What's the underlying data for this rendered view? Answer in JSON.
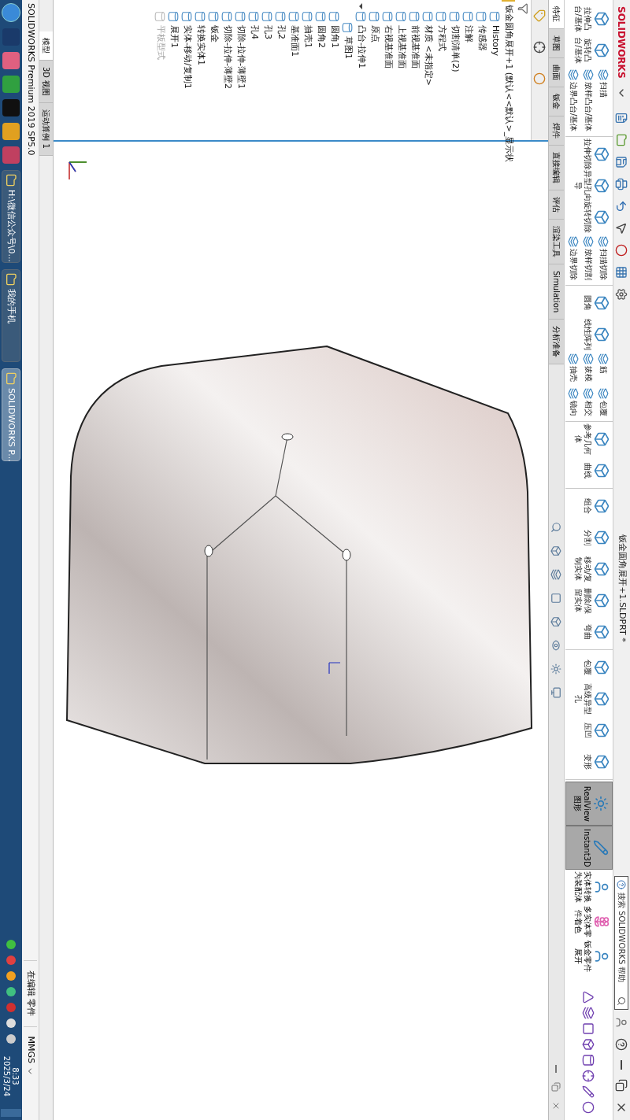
{
  "title_bar": {
    "logo": "SOLIDWORKS",
    "title": "钣金圆角展开+1.SLDPRT *",
    "search": {
      "placeholder": "搜索 SOLIDWORKS 帮助"
    }
  },
  "ribbon": {
    "groups": [
      {
        "items": [
          {
            "kind": "large",
            "label": "拉伸凸台/基体"
          },
          {
            "kind": "large",
            "label": "旋转凸台/基体"
          },
          {
            "kind": "small",
            "label": "扫描"
          },
          {
            "kind": "small",
            "label": "放样凸台/基体"
          },
          {
            "kind": "small",
            "label": "边界凸台/基体"
          }
        ]
      },
      {
        "items": [
          {
            "kind": "large",
            "label": "拉伸切除"
          },
          {
            "kind": "large",
            "label": "异型孔向导"
          },
          {
            "kind": "large",
            "label": "旋转切除"
          },
          {
            "kind": "small",
            "label": "扫描切除"
          },
          {
            "kind": "small",
            "label": "放样切割"
          },
          {
            "kind": "small",
            "label": "边界切除"
          }
        ]
      },
      {
        "items": [
          {
            "kind": "large",
            "label": "圆角"
          },
          {
            "kind": "large",
            "label": "线性阵列"
          },
          {
            "kind": "small",
            "label": "筋"
          },
          {
            "kind": "small",
            "label": "拔模"
          },
          {
            "kind": "small",
            "label": "抽壳"
          },
          {
            "kind": "small",
            "label": "包覆"
          },
          {
            "kind": "small",
            "label": "相交"
          },
          {
            "kind": "small",
            "label": "镜向"
          }
        ]
      },
      {
        "items": [
          {
            "kind": "large",
            "label": "参考几何体"
          },
          {
            "kind": "large",
            "label": "曲线"
          }
        ]
      },
      {
        "items": [
          {
            "kind": "large",
            "label": "组合"
          },
          {
            "kind": "large",
            "label": "分割"
          },
          {
            "kind": "large",
            "label": "移动/复制实体"
          },
          {
            "kind": "large",
            "label": "删除/保留实体"
          },
          {
            "kind": "large",
            "label": "弯曲"
          }
        ]
      },
      {
        "items": [
          {
            "kind": "large",
            "label": "包覆"
          },
          {
            "kind": "large",
            "label": "高级异型孔"
          },
          {
            "kind": "large",
            "label": "压凹"
          },
          {
            "kind": "large",
            "label": "变形"
          }
        ]
      }
    ],
    "toggles": [
      {
        "label": "RealView 图形",
        "pressed": true
      },
      {
        "label": "Instant3D",
        "pressed": true
      }
    ],
    "extras": [
      {
        "label": "实体转换为装配体"
      },
      {
        "label": "多实体零件着色"
      },
      {
        "label": "钣金零件展开"
      }
    ]
  },
  "tabs": [
    {
      "label": "特征",
      "selected": true
    },
    {
      "label": "草图",
      "selected": false
    },
    {
      "label": "曲面",
      "selected": false
    },
    {
      "label": "钣金",
      "selected": false
    },
    {
      "label": "焊件",
      "selected": false
    },
    {
      "label": "直接编辑",
      "selected": false
    },
    {
      "label": "评估",
      "selected": false
    },
    {
      "label": "渲染工具",
      "selected": false
    },
    {
      "label": "Simulation",
      "selected": false
    },
    {
      "label": "分析准备",
      "selected": false
    }
  ],
  "feature_tree": {
    "root": "钣金圆角展开+1 (默认<<默认>_显示状",
    "items": [
      {
        "label": "History",
        "disabled": false
      },
      {
        "label": "传感器",
        "disabled": false
      },
      {
        "label": "注解",
        "disabled": false
      },
      {
        "label": "切割清单(2)",
        "disabled": false
      },
      {
        "label": "方程式",
        "disabled": false
      },
      {
        "label": "材质 <未指定>",
        "disabled": false
      },
      {
        "label": "前视基准面",
        "disabled": false
      },
      {
        "label": "上视基准面",
        "disabled": false
      },
      {
        "label": "右视基准面",
        "disabled": false
      },
      {
        "label": "原点",
        "disabled": false
      },
      {
        "label": "凸台-拉伸1",
        "disabled": false,
        "expanded": true,
        "children": [
          {
            "label": "草图1",
            "disabled": false
          }
        ]
      },
      {
        "label": "圆角1",
        "disabled": false
      },
      {
        "label": "圆角2",
        "disabled": false
      },
      {
        "label": "抽壳1",
        "disabled": false
      },
      {
        "label": "基准面1",
        "disabled": false
      },
      {
        "label": "孔2",
        "disabled": false
      },
      {
        "label": "孔3",
        "disabled": false
      },
      {
        "label": "孔4",
        "disabled": false
      },
      {
        "label": "切除-拉伸-薄壁1",
        "disabled": false
      },
      {
        "label": "切除-拉伸-薄壁2",
        "disabled": false
      },
      {
        "label": "钣金",
        "disabled": false
      },
      {
        "label": "转换实体1",
        "disabled": false
      },
      {
        "label": "实体-移动/复制1",
        "disabled": false
      },
      {
        "label": "展开1",
        "disabled": false
      },
      {
        "label": "平板型式",
        "disabled": true
      }
    ]
  },
  "model_tabs": [
    {
      "label": "模型",
      "selected": true
    },
    {
      "label": "3D 视图",
      "selected": false
    },
    {
      "label": "运动算例 1",
      "selected": false
    }
  ],
  "status_bar": {
    "product": "SOLIDWORKS Premium 2019 SP5.0",
    "mode": "在编辑 零件",
    "units": "MMGS"
  },
  "taskbar": {
    "tasks": [
      {
        "label": "H:\\微信公众号\\0...",
        "selected": false
      },
      {
        "label": "我的手机",
        "selected": false
      },
      {
        "label": "SOLIDWORKS P...",
        "selected": true
      }
    ],
    "time": "8:33",
    "date": "2025/3/24"
  }
}
